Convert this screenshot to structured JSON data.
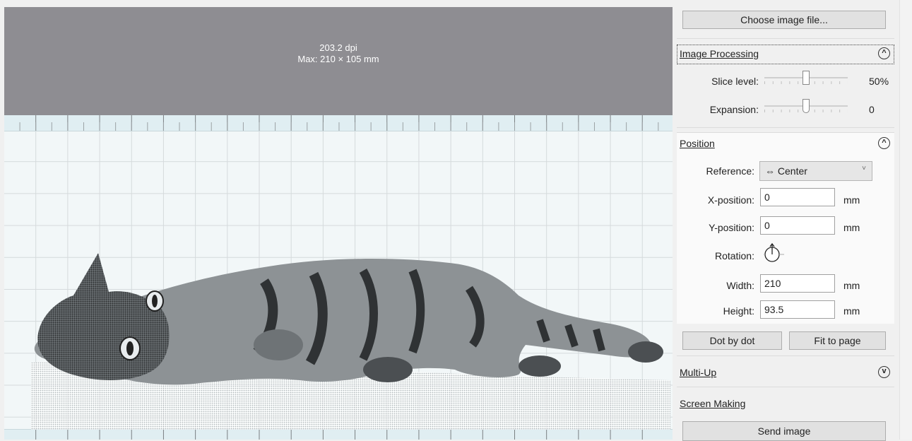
{
  "preview": {
    "dpi": "203.2 dpi",
    "max_size": "Max: 210 × 105 mm"
  },
  "panel": {
    "choose_file_label": "Choose image file...",
    "image_processing": {
      "title": "Image Processing",
      "slice_label": "Slice level:",
      "slice_value": "50%",
      "slice_level": 0.5,
      "expansion_label": "Expansion:",
      "expansion_value": "0",
      "expansion_level": 0.5
    },
    "position": {
      "title": "Position",
      "reference_label": "Reference:",
      "reference_value": "⇔ Center",
      "x_label": "X-position:",
      "x_value": "0",
      "y_label": "Y-position:",
      "y_value": "0",
      "unit": "mm",
      "rotation_label": "Rotation:",
      "width_label": "Width:",
      "width_value": "210",
      "height_label": "Height:",
      "height_value": "93.5"
    },
    "dot_by_dot_label": "Dot by dot",
    "fit_to_page_label": "Fit to page",
    "multi_up_title": "Multi-Up",
    "screen_making_title": "Screen Making",
    "send_image_label": "Send image"
  },
  "icons": {
    "collapse": "chevron-up-icon",
    "expand": "chevron-down-icon",
    "rotation": "rotation-dial-icon"
  },
  "colors": {
    "info_bar": "#8e8d92",
    "paper": "#f2f7f8",
    "ruler": "#e0eef2"
  }
}
